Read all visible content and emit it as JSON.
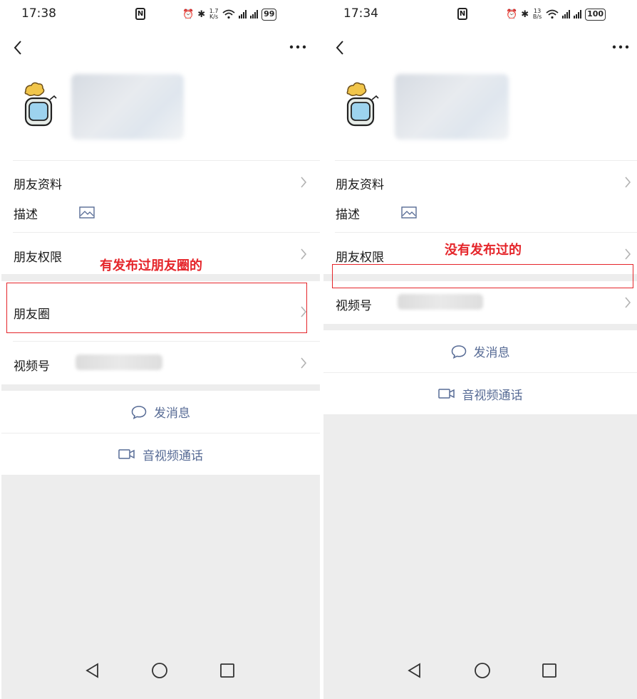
{
  "left": {
    "status": {
      "time": "17:38",
      "nfc": "N",
      "speed_top": "1.7",
      "speed_unit": "K/s",
      "battery": "99"
    },
    "rows": {
      "profile_info": "朋友资料",
      "description": "描述",
      "permissions": "朋友权限",
      "moments": "朋友圈",
      "channels": "视频号"
    },
    "actions": {
      "message": "发消息",
      "call": "音视频通话"
    },
    "annotation": "有发布过朋友圈的"
  },
  "right": {
    "status": {
      "time": "17:34",
      "nfc": "N",
      "speed_top": "13",
      "speed_unit": "B/s",
      "battery": "100"
    },
    "rows": {
      "profile_info": "朋友资料",
      "description": "描述",
      "permissions": "朋友权限",
      "channels": "视频号"
    },
    "actions": {
      "message": "发消息",
      "call": "音视频通话"
    },
    "annotation": "没有发布过的"
  },
  "colors": {
    "accent": "#576b95",
    "annotation": "#e5252a",
    "background_gray": "#ededed"
  },
  "icons": [
    "back-arrow-icon",
    "more-dots-icon",
    "chevron-right-icon",
    "picture-icon",
    "chat-bubble-icon",
    "video-camera-icon",
    "nav-back-icon",
    "nav-home-icon",
    "nav-recent-icon",
    "alarm-icon",
    "bluetooth-icon",
    "wifi-icon",
    "signal-icon"
  ]
}
